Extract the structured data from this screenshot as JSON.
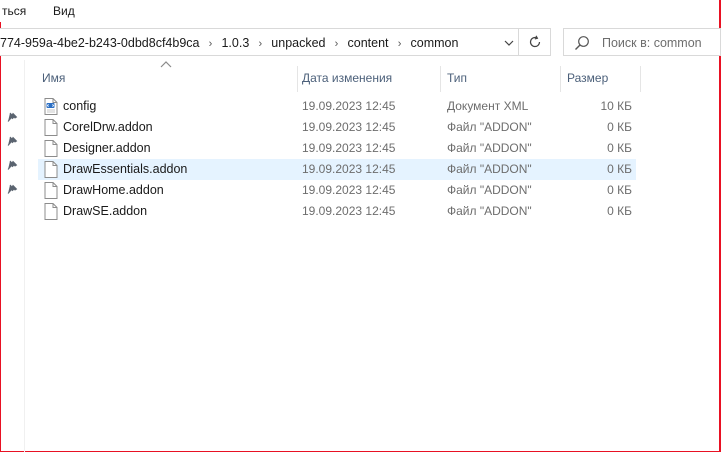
{
  "menu": {
    "items": [
      "ться",
      "Вид"
    ]
  },
  "address": {
    "crumbs": [
      "774-959a-4be2-b243-0dbd8cf4b9ca",
      "1.0.3",
      "unpacked",
      "content",
      "common"
    ]
  },
  "search": {
    "placeholder": "Поиск в: common"
  },
  "columns": {
    "name": "Имя",
    "date": "Дата изменения",
    "type": "Тип",
    "size": "Размер"
  },
  "files": [
    {
      "name": "config",
      "date": "19.09.2023 12:45",
      "type": "Документ XML",
      "size": "10 КБ",
      "icon": "xml-file-icon"
    },
    {
      "name": "CorelDrw.addon",
      "date": "19.09.2023 12:45",
      "type": "Файл \"ADDON\"",
      "size": "0 КБ",
      "icon": "file-icon"
    },
    {
      "name": "Designer.addon",
      "date": "19.09.2023 12:45",
      "type": "Файл \"ADDON\"",
      "size": "0 КБ",
      "icon": "file-icon"
    },
    {
      "name": "DrawEssentials.addon",
      "date": "19.09.2023 12:45",
      "type": "Файл \"ADDON\"",
      "size": "0 КБ",
      "icon": "file-icon"
    },
    {
      "name": "DrawHome.addon",
      "date": "19.09.2023 12:45",
      "type": "Файл \"ADDON\"",
      "size": "0 КБ",
      "icon": "file-icon"
    },
    {
      "name": "DrawSE.addon",
      "date": "19.09.2023 12:45",
      "type": "Файл \"ADDON\"",
      "size": "0 КБ",
      "icon": "file-icon"
    }
  ],
  "selected_row": 3,
  "colors": {
    "frame_border": "#e81123",
    "selection": "#e5f3ff",
    "header_text": "#4c607a",
    "secondary_text": "#6d6d6d"
  }
}
